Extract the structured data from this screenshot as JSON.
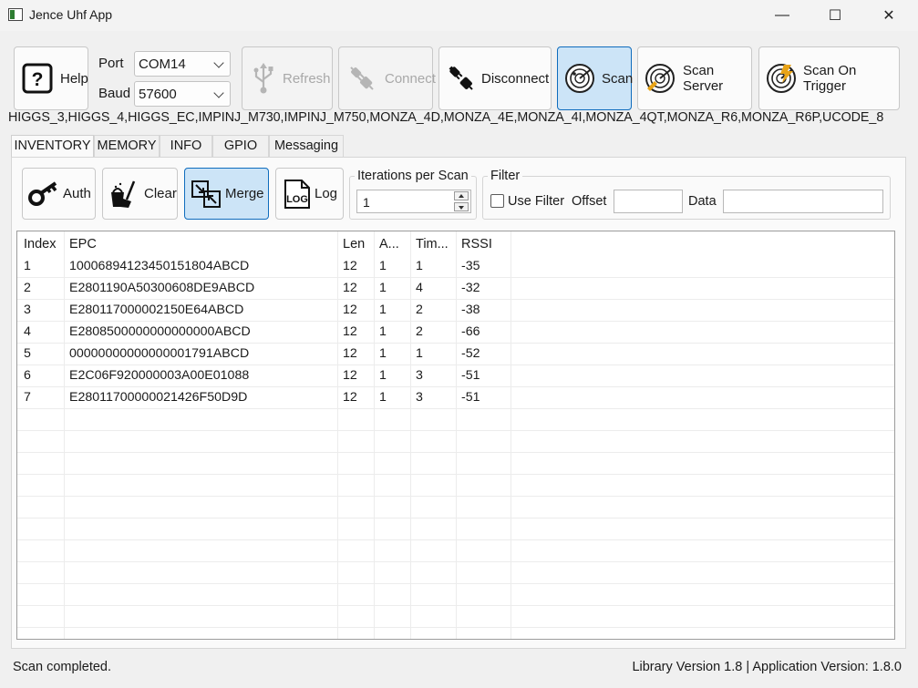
{
  "window": {
    "title": "Jence Uhf App",
    "controls": {
      "minimize": "—",
      "maximize": "☐",
      "close": "✕"
    }
  },
  "toolbar": {
    "help": "Help",
    "port_label": "Port",
    "port_value": "COM14",
    "baud_label": "Baud",
    "baud_value": "57600",
    "refresh": "Refresh",
    "connect": "Connect",
    "disconnect": "Disconnect",
    "scan": "Scan",
    "scan_server": "Scan Server",
    "scan_on_trigger": "Scan On Trigger"
  },
  "supported_chips": "HIGGS_3,HIGGS_4,HIGGS_EC,IMPINJ_M730,IMPINJ_M750,MONZA_4D,MONZA_4E,MONZA_4I,MONZA_4QT,MONZA_R6,MONZA_R6P,UCODE_8",
  "tabs": [
    "INVENTORY",
    "MEMORY",
    "INFO",
    "GPIO",
    "Messaging"
  ],
  "inventory": {
    "auth": "Auth",
    "clear": "Clear",
    "merge": "Merge",
    "log": "Log",
    "log_icon_text": "LOG",
    "iterations_title": "Iterations per Scan",
    "iterations_value": "1",
    "filter_title": "Filter",
    "use_filter": "Use Filter",
    "offset_label": "Offset",
    "data_label": "Data"
  },
  "table": {
    "columns": [
      "Index",
      "EPC",
      "Len",
      "A...",
      "Tim...",
      "RSSI"
    ],
    "rows": [
      [
        "1",
        "10006894123450151804ABCD",
        "12",
        "1",
        "1",
        "-35"
      ],
      [
        "2",
        "E2801190A50300608DE9ABCD",
        "12",
        "1",
        "4",
        "-32"
      ],
      [
        "3",
        "E280117000002150E64ABCD",
        "12",
        "1",
        "2",
        "-38"
      ],
      [
        "4",
        "E2808500000000000000ABCD",
        "12",
        "1",
        "2",
        "-66"
      ],
      [
        "5",
        "00000000000000001791ABCD",
        "12",
        "1",
        "1",
        "-52"
      ],
      [
        "6",
        "E2C06F920000003A00E01088",
        "12",
        "1",
        "3",
        "-51"
      ],
      [
        "7",
        "E28011700000021426F50D9D",
        "12",
        "1",
        "3",
        "-51"
      ]
    ]
  },
  "status": {
    "message": "Scan completed.",
    "version": "Library Version 1.8 | Application Version: 1.8.0"
  },
  "colors": {
    "active_bg": "#cce4f7",
    "active_border": "#0f6cbd",
    "disabled_text": "#a8a8a8"
  },
  "icons": [
    "question-icon",
    "usb-icon",
    "plug-icon",
    "unplug-icon",
    "radar-icon",
    "key-icon",
    "broom-icon",
    "merge-icon",
    "log-icon"
  ]
}
